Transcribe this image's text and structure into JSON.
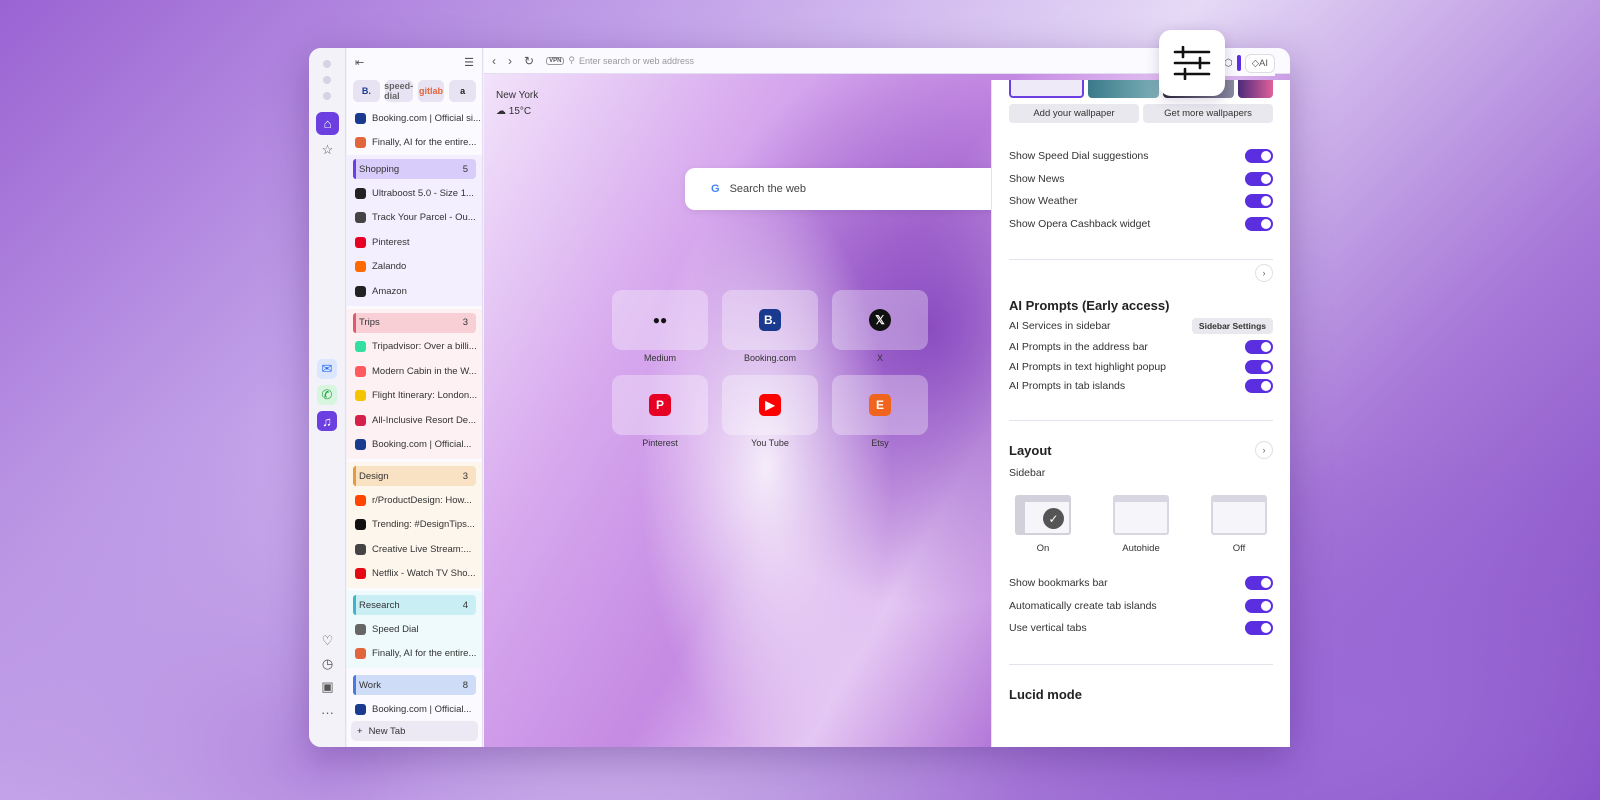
{
  "address_bar": {
    "placeholder": "Enter search or web address",
    "vpn": "VPN",
    "ai_label": "AI"
  },
  "tabs": {
    "pinned": [
      "B.",
      "speed-dial",
      "gitlab",
      "a"
    ],
    "loose": [
      {
        "title": "Booking.com | Official si...",
        "icon": "booking",
        "color": "#1a3a8f"
      },
      {
        "title": "Finally, AI for the entire...",
        "icon": "gitlab",
        "color": "#e2663b"
      }
    ],
    "islands": [
      {
        "name": "Shopping",
        "count": "5",
        "tabs": [
          {
            "title": "Ultraboost 5.0 - Size 1...",
            "icon": "adidas",
            "color": "#222"
          },
          {
            "title": "Track Your Parcel - Ou...",
            "icon": "parcel",
            "color": "#444"
          },
          {
            "title": "Pinterest",
            "icon": "pinterest",
            "color": "#e60023"
          },
          {
            "title": "Zalando",
            "icon": "zalando",
            "color": "#ff6900"
          },
          {
            "title": "Amazon",
            "icon": "amazon",
            "color": "#222"
          }
        ]
      },
      {
        "name": "Trips",
        "count": "3",
        "tabs": [
          {
            "title": "Tripadvisor: Over a billi...",
            "icon": "tripadvisor",
            "color": "#34e0a1"
          },
          {
            "title": "Modern Cabin in the W...",
            "icon": "airbnb",
            "color": "#ff5a5f"
          },
          {
            "title": "Flight Itinerary: London...",
            "icon": "flight",
            "color": "#f5c400"
          },
          {
            "title": "All-Inclusive Resort De...",
            "icon": "tui",
            "color": "#d4204b"
          },
          {
            "title": "Booking.com | Official...",
            "icon": "booking",
            "color": "#1a3a8f"
          }
        ]
      },
      {
        "name": "Design",
        "count": "3",
        "tabs": [
          {
            "title": "r/ProductDesign: How...",
            "icon": "reddit",
            "color": "#ff4500"
          },
          {
            "title": "Trending: #DesignTips...",
            "icon": "tiktok",
            "color": "#111"
          },
          {
            "title": "Creative Live Stream:...",
            "icon": "twitch",
            "color": "#444"
          },
          {
            "title": "Netflix - Watch TV Sho...",
            "icon": "netflix",
            "color": "#e50914"
          }
        ]
      },
      {
        "name": "Research",
        "count": "4",
        "tabs": [
          {
            "title": "Speed Dial",
            "icon": "speed-dial",
            "color": "#666"
          },
          {
            "title": "Finally, AI for the entire...",
            "icon": "gitlab",
            "color": "#e2663b"
          }
        ]
      },
      {
        "name": "Work",
        "count": "8",
        "tabs": [
          {
            "title": "Booking.com | Official...",
            "icon": "booking",
            "color": "#1a3a8f"
          }
        ]
      }
    ],
    "new_tab": "New Tab"
  },
  "weather": {
    "city": "New York",
    "temp": "15°C"
  },
  "search": {
    "placeholder": "Search the web",
    "logo": "G"
  },
  "speed_dial": [
    {
      "label": "Medium",
      "icon": "medium",
      "color": "#111"
    },
    {
      "label": "Booking.com",
      "icon": "booking",
      "color": "#1a3a8f"
    },
    {
      "label": "X",
      "icon": "x",
      "color": "#111"
    },
    {
      "label": "Pinterest",
      "icon": "pinterest",
      "color": "#e60023"
    },
    {
      "label": "You Tube",
      "icon": "youtube",
      "color": "#ff0000"
    },
    {
      "label": "Etsy",
      "icon": "etsy",
      "color": "#f1641e"
    }
  ],
  "panel": {
    "wallpaper_buttons": [
      "Add your wallpaper",
      "Get more wallpapers"
    ],
    "start_page_toggles": [
      "Show Speed Dial suggestions",
      "Show News",
      "Show Weather",
      "Show Opera Cashback widget"
    ],
    "ai_title": "AI Prompts (Early access)",
    "ai_services": "AI Services in sidebar",
    "sidebar_settings": "Sidebar Settings",
    "ai_toggles": [
      "AI Prompts in the address bar",
      "AI Prompts in text highlight popup",
      "AI Prompts in tab islands"
    ],
    "layout_title": "Layout",
    "sidebar_label": "Sidebar",
    "layout_options": [
      "On",
      "Autohide",
      "Off"
    ],
    "layout_toggles": [
      "Show bookmarks bar",
      "Automatically create tab islands",
      "Use vertical tabs"
    ],
    "lucid_title": "Lucid mode"
  },
  "colors": {
    "accent": "#5b2fe0"
  }
}
